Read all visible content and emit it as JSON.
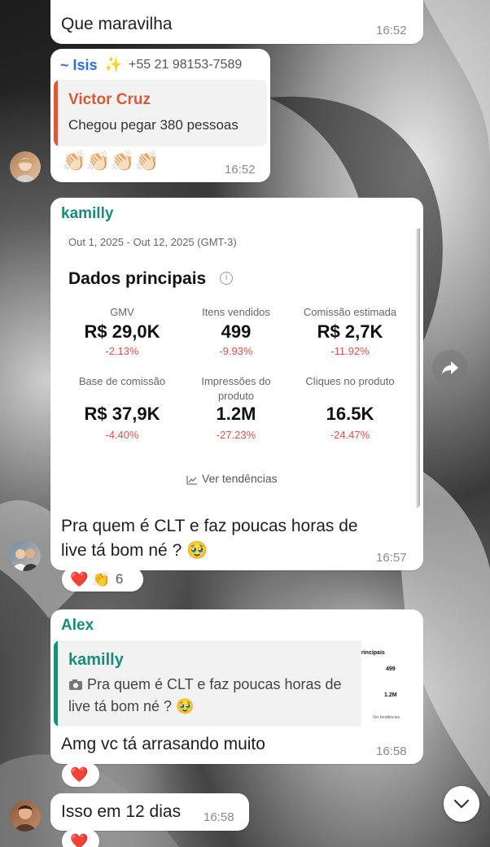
{
  "messages": {
    "m1": {
      "text": "Que maravilha",
      "time": "16:52"
    },
    "m2": {
      "sender_name": "~ Isis",
      "sender_emoji": "✨",
      "sender_phone": "+55 21 98153-7589",
      "quote_author": "Victor Cruz",
      "quote_text": "Chegou pegar 380 pessoas",
      "text": "👏🏻👏🏻👏🏻👏🏻",
      "time": "16:52"
    },
    "m3": {
      "sender": "kamilly",
      "date_range": "Out 1, 2025 - Out 12, 2025 (GMT-3)",
      "dashboard_title": "Dados principais",
      "stats": [
        {
          "label": "GMV",
          "value": "R$ 29,0K",
          "delta": "-2.13%"
        },
        {
          "label": "Itens vendidos",
          "value": "499",
          "delta": "-9.93%"
        },
        {
          "label": "Comissão estimada",
          "value": "R$ 2,7K",
          "delta": "-11.92%"
        },
        {
          "label": "Base de comissão",
          "value": "R$ 37,9K",
          "delta": "-4.40%"
        },
        {
          "label": "Impressões do produto",
          "value": "1.2M",
          "delta": "-27.23%"
        },
        {
          "label": "Cliques no produto",
          "value": "16.5K",
          "delta": "-24.47%"
        }
      ],
      "trend_link": "Ver tendências",
      "caption_line1": "Pra quem é CLT e faz poucas horas de",
      "caption_line2": "live tá bom né ? 🥹",
      "time": "16:57",
      "reactions": "❤️ 👏",
      "reaction_count": "6"
    },
    "m4": {
      "sender": "Alex",
      "quote_author": "kamilly",
      "quote_icon": "camera-icon",
      "quote_line1": "Pra quem é CLT e faz poucas horas de",
      "quote_line2": "live tá bom né ? 🥹",
      "thumb_title": "rincipais",
      "thumb_v1": "499",
      "thumb_v2": "1.2M",
      "thumb_link": "Ver tendências",
      "text": "Amg vc tá arrasando muito",
      "time": "16:58",
      "reaction": "❤️"
    },
    "m5": {
      "text": "Isso em 12 dias",
      "time": "16:58",
      "reaction": "❤️"
    }
  },
  "icons": {
    "forward": "forward-arrow-icon",
    "scroll_down": "chevron-down-icon",
    "info": "info-icon",
    "trend": "trend-chart-icon"
  },
  "colors": {
    "sender_green": "#1a8c7a",
    "sender_blue": "#2f6fd6",
    "quote_bar_red": "#d65a3a",
    "delta_red": "#e0504b"
  }
}
